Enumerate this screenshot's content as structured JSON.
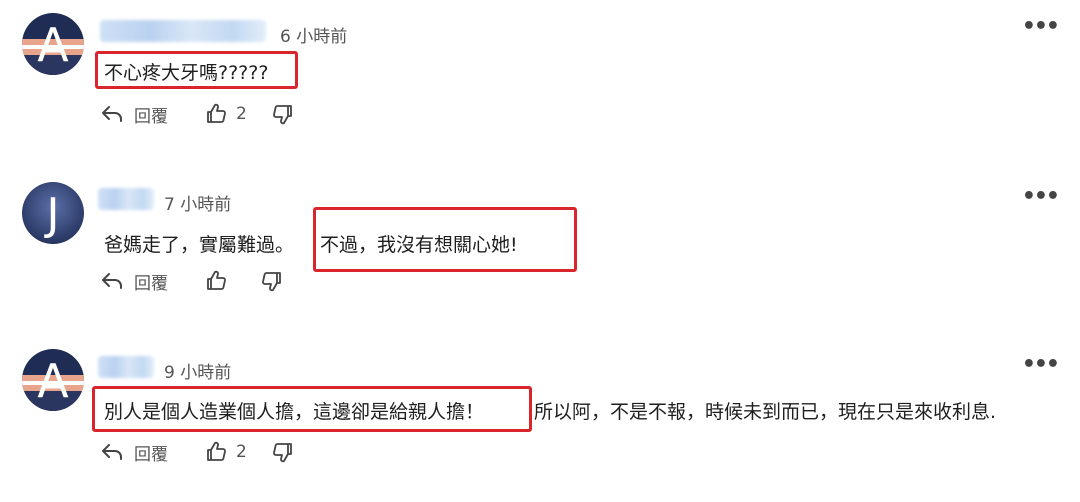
{
  "comments": [
    {
      "avatar_letter": "A",
      "time": "6 小時前",
      "text": "不心疼大牙嗎?????",
      "highlighted_text": "不心疼大牙嗎?????",
      "reply_label": "回覆",
      "likes": "2"
    },
    {
      "avatar_letter": "J",
      "time": "7 小時前",
      "text_plain": "爸媽走了，實屬難過。",
      "highlighted_text": "不過，我沒有想關心她!",
      "reply_label": "回覆",
      "likes": ""
    },
    {
      "avatar_letter": "A",
      "time": "9 小時前",
      "highlighted_text": "別人是個人造業個人擔，這邊卻是給親人擔！",
      "text_plain": "所以阿，不是不報，時候未到而已，現在只是來收利息.",
      "reply_label": "回覆",
      "likes": "2"
    }
  ],
  "icons": {
    "more": "more-horizontal-icon",
    "reply": "reply-arrow-icon",
    "like": "thumb-up-icon",
    "dislike": "thumb-down-icon"
  },
  "colors": {
    "highlight_border": "#d9262c",
    "avatar_a_top": "#1f2d54",
    "avatar_a_stripe": "#e9a58c",
    "avatar_j": "#3a4f8c"
  }
}
